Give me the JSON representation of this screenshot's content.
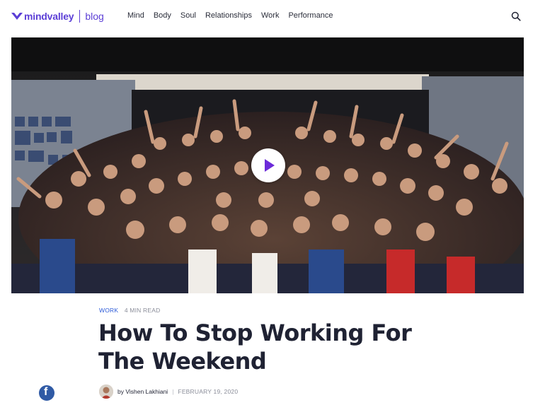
{
  "brand": {
    "name": "mindvalley",
    "section": "blog",
    "color": "#5c3fd6"
  },
  "nav": {
    "items": [
      "Mind",
      "Body",
      "Soul",
      "Relationships",
      "Work",
      "Performance"
    ]
  },
  "search": {
    "icon": "search-icon"
  },
  "hero": {
    "image": "group-photo-crowd-waving",
    "play_icon": "play-icon"
  },
  "article": {
    "category": "WORK",
    "read_time": "4 MIN READ",
    "title": "How To Stop Working For The Weekend",
    "author": "by Vishen Lakhiani",
    "separator": "|",
    "date": "FEBRUARY 19, 2020",
    "category_color": "#2d5bd8"
  },
  "share": {
    "facebook_glyph": "f",
    "facebook_color": "#2f5aa5"
  }
}
